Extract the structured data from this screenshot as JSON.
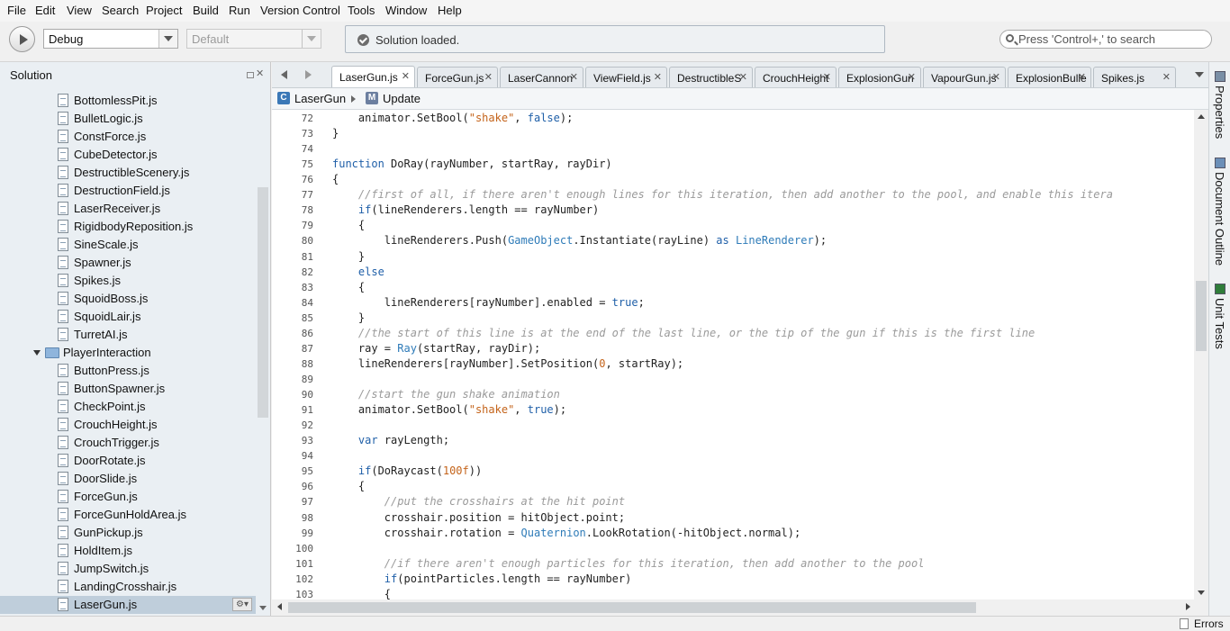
{
  "menu": [
    "File",
    "Edit",
    "View",
    "Search",
    "Project",
    "Build",
    "Run",
    "Version Control",
    "Tools",
    "Window",
    "Help"
  ],
  "toolbar": {
    "config": "Debug",
    "platform": "Default",
    "status": "Solution loaded.",
    "search_placeholder": "Press 'Control+,' to search"
  },
  "solution": {
    "title": "Solution",
    "close_glyph": "✕",
    "items": [
      {
        "label": "BottomlessPit.js",
        "type": "file"
      },
      {
        "label": "BulletLogic.js",
        "type": "file"
      },
      {
        "label": "ConstForce.js",
        "type": "file"
      },
      {
        "label": "CubeDetector.js",
        "type": "file"
      },
      {
        "label": "DestructibleScenery.js",
        "type": "file"
      },
      {
        "label": "DestructionField.js",
        "type": "file"
      },
      {
        "label": "LaserReceiver.js",
        "type": "file"
      },
      {
        "label": "RigidbodyReposition.js",
        "type": "file"
      },
      {
        "label": "SineScale.js",
        "type": "file"
      },
      {
        "label": "Spawner.js",
        "type": "file"
      },
      {
        "label": "Spikes.js",
        "type": "file"
      },
      {
        "label": "SquoidBoss.js",
        "type": "file"
      },
      {
        "label": "SquoidLair.js",
        "type": "file"
      },
      {
        "label": "TurretAI.js",
        "type": "file"
      },
      {
        "label": "PlayerInteraction",
        "type": "folder"
      },
      {
        "label": "ButtonPress.js",
        "type": "file"
      },
      {
        "label": "ButtonSpawner.js",
        "type": "file"
      },
      {
        "label": "CheckPoint.js",
        "type": "file"
      },
      {
        "label": "CrouchHeight.js",
        "type": "file"
      },
      {
        "label": "CrouchTrigger.js",
        "type": "file"
      },
      {
        "label": "DoorRotate.js",
        "type": "file"
      },
      {
        "label": "DoorSlide.js",
        "type": "file"
      },
      {
        "label": "ForceGun.js",
        "type": "file"
      },
      {
        "label": "ForceGunHoldArea.js",
        "type": "file"
      },
      {
        "label": "GunPickup.js",
        "type": "file"
      },
      {
        "label": "HoldItem.js",
        "type": "file"
      },
      {
        "label": "JumpSwitch.js",
        "type": "file"
      },
      {
        "label": "LandingCrosshair.js",
        "type": "file"
      },
      {
        "label": "LaserGun.js",
        "type": "file",
        "selected": true
      }
    ]
  },
  "tabs": [
    {
      "label": "LaserGun.js",
      "active": true
    },
    {
      "label": "ForceGun.js"
    },
    {
      "label": "LaserCannon"
    },
    {
      "label": "ViewField.js"
    },
    {
      "label": "DestructibleS"
    },
    {
      "label": "CrouchHeight"
    },
    {
      "label": "ExplosionGun"
    },
    {
      "label": "VapourGun.js"
    },
    {
      "label": "ExplosionBulle"
    },
    {
      "label": "Spikes.js"
    }
  ],
  "tab_close_glyph": "✕",
  "breadcrumb": {
    "class_icon": "C",
    "class_name": "LaserGun",
    "method_icon": "M",
    "method_name": "Update"
  },
  "code": {
    "lines": [
      {
        "n": "72",
        "t": [
          [
            "    animator.SetBool(",
            ""
          ],
          [
            "\"shake\"",
            "st"
          ],
          [
            ", ",
            ""
          ],
          [
            "false",
            "kw"
          ],
          [
            ");",
            ""
          ]
        ]
      },
      {
        "n": "73",
        "t": [
          [
            "}",
            ""
          ]
        ]
      },
      {
        "n": "74",
        "t": []
      },
      {
        "n": "75",
        "t": [
          [
            "function",
            "kw"
          ],
          [
            " DoRay(rayNumber, startRay, rayDir)",
            ""
          ]
        ]
      },
      {
        "n": "76",
        "t": [
          [
            "{",
            ""
          ]
        ]
      },
      {
        "n": "77",
        "t": [
          [
            "    //first of all, if there aren't enough lines for this iteration, then add another to the pool, and enable this itera",
            "cm"
          ]
        ]
      },
      {
        "n": "78",
        "t": [
          [
            "    ",
            ""
          ],
          [
            "if",
            "kw"
          ],
          [
            "(lineRenderers.length == rayNumber)",
            ""
          ]
        ]
      },
      {
        "n": "79",
        "t": [
          [
            "    {",
            ""
          ]
        ]
      },
      {
        "n": "80",
        "t": [
          [
            "        lineRenderers.Push(",
            ""
          ],
          [
            "GameObject",
            "ty"
          ],
          [
            ".Instantiate(rayLine) ",
            ""
          ],
          [
            "as",
            "kw"
          ],
          [
            " ",
            ""
          ],
          [
            "LineRenderer",
            "ty"
          ],
          [
            ");",
            ""
          ]
        ]
      },
      {
        "n": "81",
        "t": [
          [
            "    }",
            ""
          ]
        ]
      },
      {
        "n": "82",
        "t": [
          [
            "    ",
            ""
          ],
          [
            "else",
            "kw"
          ]
        ]
      },
      {
        "n": "83",
        "t": [
          [
            "    {",
            ""
          ]
        ]
      },
      {
        "n": "84",
        "t": [
          [
            "        lineRenderers[rayNumber].enabled = ",
            ""
          ],
          [
            "true",
            "kw"
          ],
          [
            ";",
            ""
          ]
        ]
      },
      {
        "n": "85",
        "t": [
          [
            "    }",
            ""
          ]
        ]
      },
      {
        "n": "86",
        "t": [
          [
            "    //the start of this line is at the end of the last line, or the tip of the gun if this is the first line",
            "cm"
          ]
        ]
      },
      {
        "n": "87",
        "t": [
          [
            "    ray = ",
            ""
          ],
          [
            "Ray",
            "ty"
          ],
          [
            "(startRay, rayDir);",
            ""
          ]
        ]
      },
      {
        "n": "88",
        "t": [
          [
            "    lineRenderers[rayNumber].SetPosition(",
            ""
          ],
          [
            "0",
            "nm"
          ],
          [
            ", startRay);",
            ""
          ]
        ]
      },
      {
        "n": "89",
        "t": []
      },
      {
        "n": "90",
        "t": [
          [
            "    //start the gun shake animation",
            "cm"
          ]
        ]
      },
      {
        "n": "91",
        "t": [
          [
            "    animator.SetBool(",
            ""
          ],
          [
            "\"shake\"",
            "st"
          ],
          [
            ", ",
            ""
          ],
          [
            "true",
            "kw"
          ],
          [
            ");",
            ""
          ]
        ]
      },
      {
        "n": "92",
        "t": []
      },
      {
        "n": "93",
        "t": [
          [
            "    ",
            ""
          ],
          [
            "var",
            "kw"
          ],
          [
            " rayLength;",
            ""
          ]
        ]
      },
      {
        "n": "94",
        "t": []
      },
      {
        "n": "95",
        "t": [
          [
            "    ",
            ""
          ],
          [
            "if",
            "kw"
          ],
          [
            "(DoRaycast(",
            ""
          ],
          [
            "100f",
            "nm"
          ],
          [
            "))",
            ""
          ]
        ]
      },
      {
        "n": "96",
        "t": [
          [
            "    {",
            ""
          ]
        ]
      },
      {
        "n": "97",
        "t": [
          [
            "        //put the crosshairs at the hit point",
            "cm"
          ]
        ]
      },
      {
        "n": "98",
        "t": [
          [
            "        crosshair.position = hitObject.point;",
            ""
          ]
        ]
      },
      {
        "n": "99",
        "t": [
          [
            "        crosshair.rotation = ",
            ""
          ],
          [
            "Quaternion",
            "ty"
          ],
          [
            ".LookRotation(-hitObject.normal);",
            ""
          ]
        ]
      },
      {
        "n": "100",
        "t": []
      },
      {
        "n": "101",
        "t": [
          [
            "        //if there aren't enough particles for this iteration, then add another to the pool",
            "cm"
          ]
        ]
      },
      {
        "n": "102",
        "t": [
          [
            "        ",
            ""
          ],
          [
            "if",
            "kw"
          ],
          [
            "(pointParticles.length == rayNumber)",
            ""
          ]
        ]
      },
      {
        "n": "103",
        "t": [
          [
            "        {",
            ""
          ]
        ]
      }
    ]
  },
  "right_pads": [
    "Properties",
    "Document Outline",
    "Unit Tests"
  ],
  "bottom": {
    "errors": "Errors"
  },
  "colors": {
    "accent": "#3a7bd5",
    "selection": "#bfcedb",
    "keyword": "#1f5fa8",
    "string": "#c4631a",
    "comment": "#9a9a9a"
  }
}
